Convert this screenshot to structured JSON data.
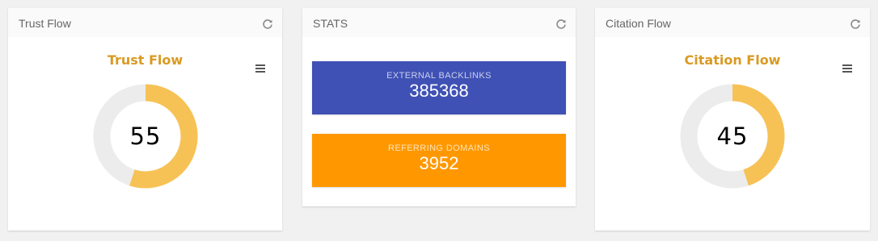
{
  "widgets": {
    "trust_flow": {
      "header_title": "Trust Flow",
      "chart_title": "Trust Flow",
      "value": "55",
      "percent": 55
    },
    "stats": {
      "header_title": "STATS",
      "external_backlinks": {
        "label": "EXTERNAL BACKLINKS",
        "value": "385368"
      },
      "referring_domains": {
        "label": "REFERRING DOMAINS",
        "value": "3952"
      }
    },
    "citation_flow": {
      "header_title": "Citation Flow",
      "chart_title": "Citation Flow",
      "value": "45",
      "percent": 45
    }
  },
  "colors": {
    "gauge_fill": "#f7c255",
    "gauge_track": "#ececec",
    "chart_title": "#d99a23",
    "backlinks_bg": "#3f51b5",
    "domains_bg": "#ff9800"
  },
  "icons": {
    "refresh": "refresh-icon",
    "menu": "hamburger-menu-icon"
  }
}
